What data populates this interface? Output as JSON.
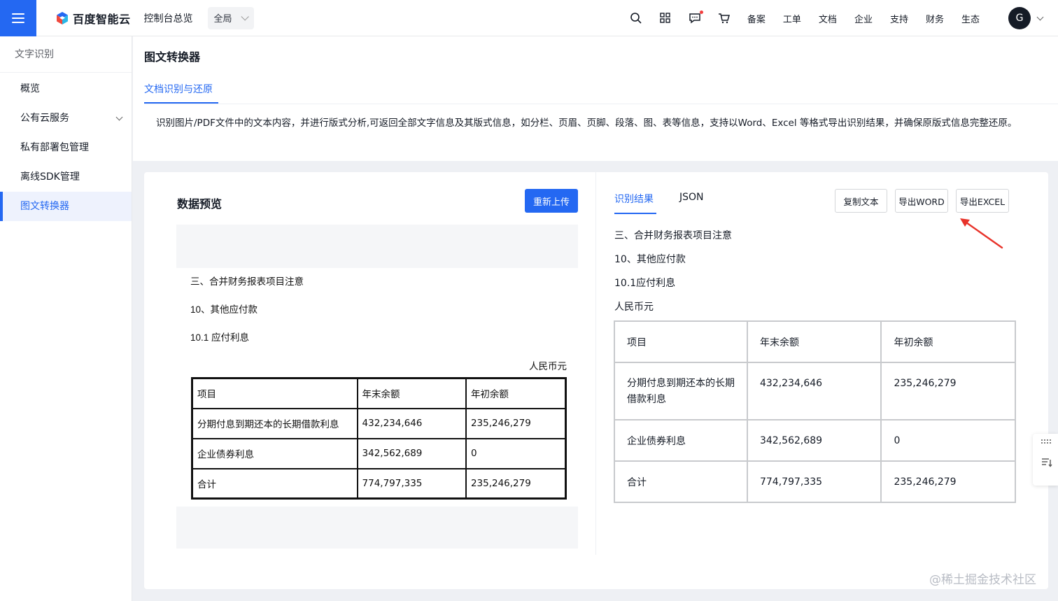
{
  "header": {
    "logo_text": "百度智能云",
    "console_link": "控制台总览",
    "region": "全局",
    "nav": [
      "备案",
      "工单",
      "文档",
      "企业",
      "支持",
      "财务",
      "生态"
    ],
    "avatar_initial": "G",
    "icons": [
      "search-icon",
      "grid-icon",
      "message-icon",
      "cart-icon"
    ]
  },
  "sidebar": {
    "title": "文字识别",
    "items": [
      {
        "label": "概览"
      },
      {
        "label": "公有云服务"
      },
      {
        "label": "私有部署包管理"
      },
      {
        "label": "离线SDK管理"
      },
      {
        "label": "图文转换器"
      }
    ]
  },
  "main": {
    "title": "图文转换器",
    "tab": "文档识别与还原",
    "description": "识别图片/PDF文件中的文本内容，并进行版式分析,可返回全部文字信息及其版式信息，如分栏、页眉、页脚、段落、图、表等信息，支持以Word、Excel 等格式导出识别结果，并确保原版式信息完整还原。"
  },
  "preview": {
    "title": "数据预览",
    "reupload": "重新上传",
    "doc": {
      "line1": "三、合并财务报表项目注意",
      "line2": "10、其他应付款",
      "line3": "10.1 应付利息",
      "currency": "人民币元",
      "table": [
        [
          "项目",
          "年末余额",
          "年初余额"
        ],
        [
          "分期付息到期还本的长期借款利息",
          "432,234,646",
          "235,246,279"
        ],
        [
          "企业债券利息",
          "342,562,689",
          "0"
        ],
        [
          "合计",
          "774,797,335",
          "235,246,279"
        ]
      ]
    }
  },
  "result": {
    "tabs": [
      "识别结果",
      "JSON"
    ],
    "buttons": {
      "copy": "复制文本",
      "word": "导出WORD",
      "excel": "导出EXCEL"
    },
    "lines": [
      "三、合并财务报表项目注意",
      "10、其他应付款",
      "10.1应付利息",
      "人民币元"
    ],
    "table": [
      [
        "项目",
        "年末余额",
        "年初余额"
      ],
      [
        "分期付息到期还本的长期借款利息",
        "432,234,646",
        "235,246,279"
      ],
      [
        "企业债券利息",
        "342,562,689",
        "0"
      ],
      [
        "合计",
        "774,797,335",
        "235,246,279"
      ]
    ]
  },
  "watermark": "@稀土掘金技术社区",
  "colors": {
    "accent": "#2468f2",
    "annotation_arrow": "#e8332a"
  }
}
